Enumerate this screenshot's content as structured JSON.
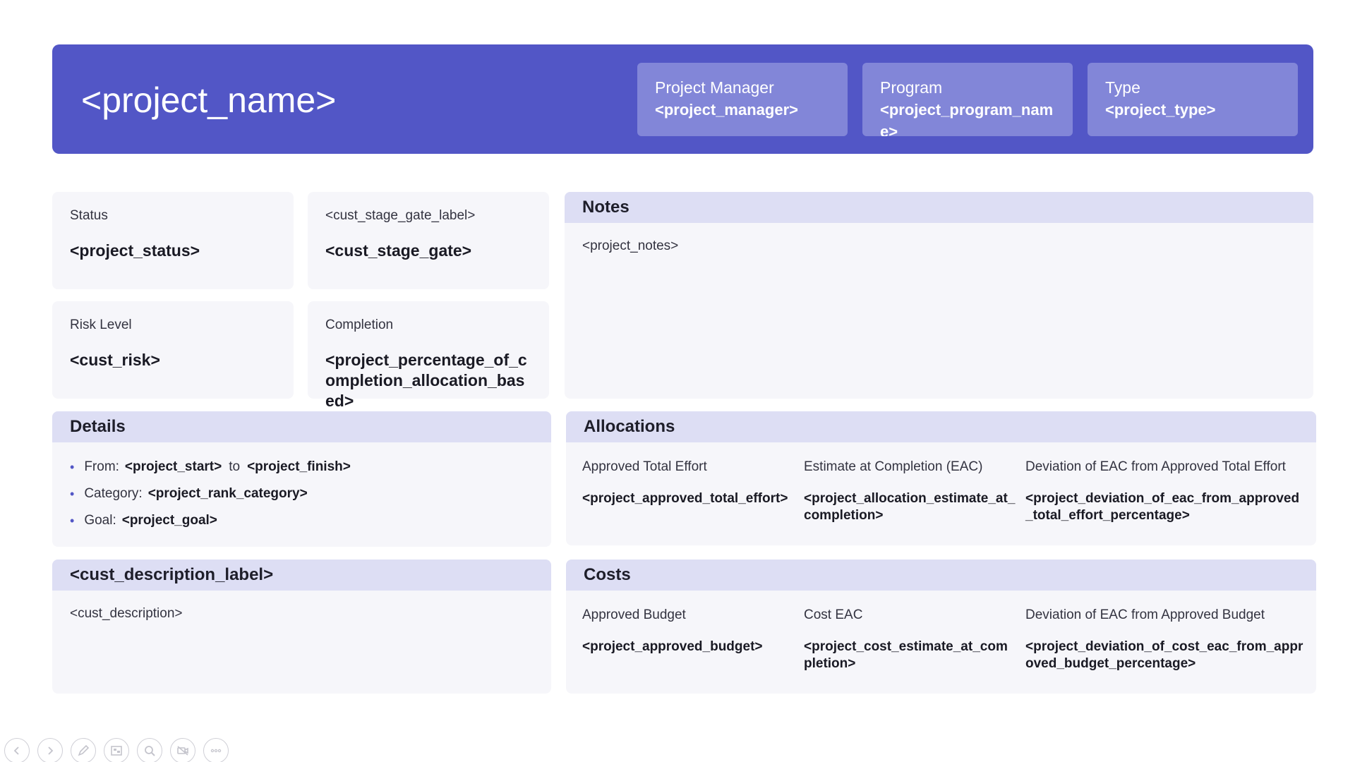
{
  "header": {
    "title": "<project_name>",
    "cards": [
      {
        "label": "Project Manager",
        "value": "<project_manager>"
      },
      {
        "label": "Program",
        "value": "<project_program_name>"
      },
      {
        "label": "Type",
        "value": "<project_type>"
      }
    ]
  },
  "tiles": {
    "status": {
      "label": "Status",
      "value": "<project_status>"
    },
    "stage_gate": {
      "label": "<cust_stage_gate_label>",
      "value": "<cust_stage_gate>"
    },
    "risk": {
      "label": "Risk Level",
      "value": "<cust_risk>"
    },
    "completion": {
      "label": "Completion",
      "value": "<project_percentage_of_completion_allocation_based>"
    }
  },
  "notes": {
    "title": "Notes",
    "body": "<project_notes>"
  },
  "details": {
    "title": "Details",
    "from_label": "From:",
    "from_value": "<project_start>",
    "to_label": "to",
    "to_value": "<project_finish>",
    "category_label": "Category:",
    "category_value": "<project_rank_category>",
    "goal_label": "Goal:",
    "goal_value": "<project_goal>"
  },
  "allocations": {
    "title": "Allocations",
    "cols": [
      {
        "label": "Approved Total Effort",
        "value": "<project_approved_total_effort>"
      },
      {
        "label": "Estimate at Completion (EAC)",
        "value": "<project_allocation_estimate_at_completion>"
      },
      {
        "label": "Deviation of EAC from Approved Total Effort",
        "value": "<project_deviation_of_eac_from_approved_total_effort_percentage>"
      }
    ]
  },
  "description": {
    "title": "<cust_description_label>",
    "body": "<cust_description>"
  },
  "costs": {
    "title": "Costs",
    "cols": [
      {
        "label": "Approved Budget",
        "value": "<project_approved_budget>"
      },
      {
        "label": "Cost EAC",
        "value": "<project_cost_estimate_at_completion>"
      },
      {
        "label": "Deviation of EAC from Approved Budget",
        "value": "<project_deviation_of_cost_eac_from_approved_budget_percentage>"
      }
    ]
  },
  "toolbar": [
    "previous-icon",
    "next-icon",
    "pen-icon",
    "slides-icon",
    "zoom-icon",
    "camera-off-icon",
    "more-icon"
  ]
}
